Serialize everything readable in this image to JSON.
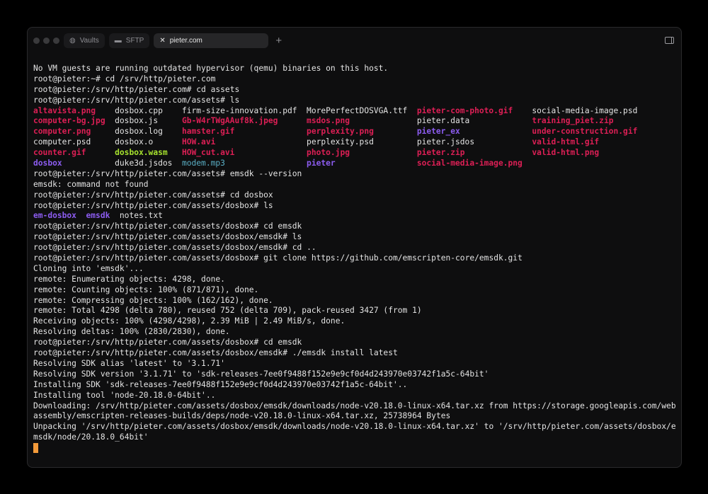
{
  "titlebar": {
    "tabs": [
      {
        "label": "Vaults",
        "icon": "vault-icon"
      },
      {
        "label": "SFTP",
        "icon": "folder-icon"
      },
      {
        "label": "pieter.com",
        "icon": "close-icon",
        "active": true
      }
    ],
    "new_tab": "+"
  },
  "colors": {
    "red": "#dc1f55",
    "purple": "#8c5cf0",
    "green": "#a6e22e",
    "cyan": "#5aaec4",
    "cursor": "#f29a3a"
  },
  "terminal": {
    "pre_lines": [
      "No VM guests are running outdated hypervisor (qemu) binaries on this host.",
      "root@pieter:~# cd /srv/http/pieter.com",
      "root@pieter:/srv/http/pieter.com# cd assets",
      "root@pieter:/srv/http/pieter.com/assets# ls"
    ],
    "ls_rows": [
      [
        [
          "altavista.png",
          "red"
        ],
        [
          "dosbox.cpp",
          ""
        ],
        [
          "firm-size-innovation.pdf",
          ""
        ],
        [
          "MorePerfectDOSVGA.ttf",
          ""
        ],
        [
          "pieter-com-photo.gif",
          "red"
        ],
        [
          "social-media-image.psd",
          ""
        ]
      ],
      [
        [
          "computer-bg.jpg",
          "red"
        ],
        [
          "dosbox.js",
          ""
        ],
        [
          "Gb-W4rTWgAAuf8k.jpeg",
          "red"
        ],
        [
          "msdos.png",
          "red"
        ],
        [
          "pieter.data",
          ""
        ],
        [
          "training_piet.zip",
          "red"
        ]
      ],
      [
        [
          "computer.png",
          "red"
        ],
        [
          "dosbox.log",
          ""
        ],
        [
          "hamster.gif",
          "red"
        ],
        [
          "perplexity.png",
          "red"
        ],
        [
          "pieter_ex",
          "purple"
        ],
        [
          "under-construction.gif",
          "red"
        ]
      ],
      [
        [
          "computer.psd",
          ""
        ],
        [
          "dosbox.o",
          ""
        ],
        [
          "HOW.avi",
          "red"
        ],
        [
          "perplexity.psd",
          ""
        ],
        [
          "pieter.jsdos",
          ""
        ],
        [
          "valid-html.gif",
          "red"
        ]
      ],
      [
        [
          "counter.gif",
          "red"
        ],
        [
          "dosbox.wasm",
          "green"
        ],
        [
          "HOW_cut.avi",
          "red"
        ],
        [
          "photo.jpg",
          "red"
        ],
        [
          "pieter.zip",
          "red"
        ],
        [
          "valid-html.png",
          "red"
        ]
      ],
      [
        [
          "dosbox",
          "purple"
        ],
        [
          "duke3d.jsdos",
          ""
        ],
        [
          "modem.mp3",
          "cyan"
        ],
        [
          "pieter",
          "purple"
        ],
        [
          "social-media-image.png",
          "red"
        ]
      ]
    ],
    "mid_lines": [
      "root@pieter:/srv/http/pieter.com/assets# emsdk --version",
      "emsdk: command not found",
      "root@pieter:/srv/http/pieter.com/assets# cd dosbox",
      "root@pieter:/srv/http/pieter.com/assets/dosbox# ls"
    ],
    "ls2": [
      [
        "em-dosbox",
        "purple"
      ],
      [
        "emsdk",
        "purple"
      ],
      [
        "notes.txt",
        ""
      ]
    ],
    "post_lines": [
      "root@pieter:/srv/http/pieter.com/assets/dosbox# cd emsdk",
      "root@pieter:/srv/http/pieter.com/assets/dosbox/emsdk# ls",
      "root@pieter:/srv/http/pieter.com/assets/dosbox/emsdk# cd ..",
      "root@pieter:/srv/http/pieter.com/assets/dosbox# git clone https://github.com/emscripten-core/emsdk.git",
      "Cloning into 'emsdk'...",
      "remote: Enumerating objects: 4298, done.",
      "remote: Counting objects: 100% (871/871), done.",
      "remote: Compressing objects: 100% (162/162), done.",
      "remote: Total 4298 (delta 780), reused 752 (delta 709), pack-reused 3427 (from 1)",
      "Receiving objects: 100% (4298/4298), 2.39 MiB | 2.49 MiB/s, done.",
      "Resolving deltas: 100% (2830/2830), done.",
      "root@pieter:/srv/http/pieter.com/assets/dosbox# cd emsdk",
      "root@pieter:/srv/http/pieter.com/assets/dosbox/emsdk# ./emsdk install latest",
      "Resolving SDK alias 'latest' to '3.1.71'",
      "Resolving SDK version '3.1.71' to 'sdk-releases-7ee0f9488f152e9e9cf0d4d243970e03742f1a5c-64bit'",
      "Installing SDK 'sdk-releases-7ee0f9488f152e9e9cf0d4d243970e03742f1a5c-64bit'..",
      "Installing tool 'node-20.18.0-64bit'..",
      "Downloading: /srv/http/pieter.com/assets/dosbox/emsdk/downloads/node-v20.18.0-linux-x64.tar.xz from https://storage.googleapis.com/web",
      "assembly/emscripten-releases-builds/deps/node-v20.18.0-linux-x64.tar.xz, 25738964 Bytes",
      "Unpacking '/srv/http/pieter.com/assets/dosbox/emsdk/downloads/node-v20.18.0-linux-x64.tar.xz' to '/srv/http/pieter.com/assets/dosbox/e",
      "msdk/node/20.18.0_64bit'"
    ]
  }
}
